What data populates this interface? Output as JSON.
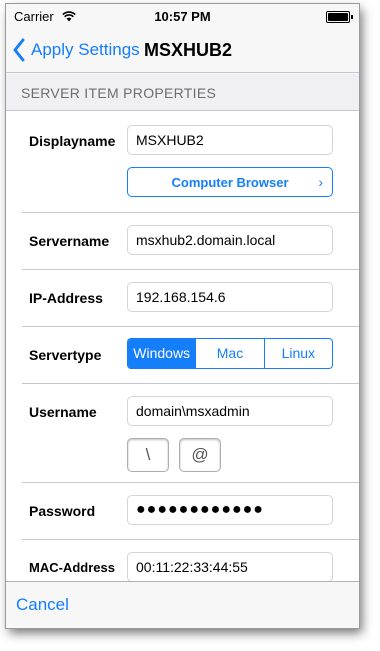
{
  "status_bar": {
    "carrier": "Carrier",
    "time": "10:57 PM"
  },
  "nav": {
    "back_label": "Apply Settings",
    "title": "MSXHUB2"
  },
  "section_header": "SERVER ITEM PROPERTIES",
  "form": {
    "displayname": {
      "label": "Displayname",
      "value": "MSXHUB2"
    },
    "computer_browser_label": "Computer Browser",
    "servername": {
      "label": "Servername",
      "value": "msxhub2.domain.local"
    },
    "ip_address": {
      "label": "IP-Address",
      "value": "192.168.154.6"
    },
    "servertype": {
      "label": "Servertype",
      "options": [
        "Windows",
        "Mac",
        "Linux"
      ],
      "selected": "Windows"
    },
    "username": {
      "label": "Username",
      "value": "domain\\msxadmin"
    },
    "insert_keys": [
      "\\",
      "@"
    ],
    "password": {
      "label": "Password",
      "value": "●●●●●●●●●●●●"
    },
    "mac_address": {
      "label": "MAC-Address",
      "value": "00:11:22:33:44:55"
    }
  },
  "toolbar": {
    "cancel_label": "Cancel"
  },
  "colors": {
    "accent": "#157efb",
    "separator": "#c8c7cc",
    "header_bg": "#efeff4"
  }
}
